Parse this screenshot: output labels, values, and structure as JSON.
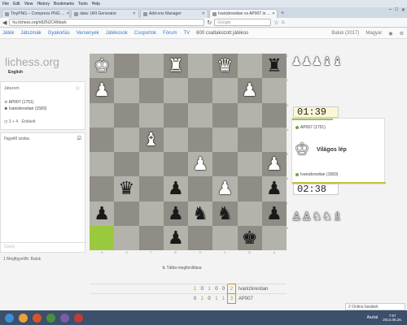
{
  "menubar": [
    "File",
    "Edit",
    "View",
    "History",
    "Bookmarks",
    "Tools",
    "Help"
  ],
  "tabs": [
    {
      "label": "TinyPNG – Compress PNG ...",
      "active": false
    },
    {
      "label": "data: URI Generator",
      "active": false
    },
    {
      "label": "Add-ons Manager",
      "active": false
    },
    {
      "label": "Ivanizkrestian vs AP007 in ...",
      "active": true
    }
  ],
  "window": {
    "min": "–",
    "max": "□",
    "close": "✕"
  },
  "url": "hu.lichess.org/n8ZNJC4/black",
  "search_placeholder": "Google",
  "nav": {
    "items": [
      "Játék",
      "Játszmák",
      "Gyakorlás",
      "Versenyek",
      "Játékosok",
      "Csoportok",
      "Fórum",
      "TV",
      "600 csatlakozott játékos"
    ],
    "user": "Baluk (2017)",
    "language": "Magyar"
  },
  "sidebar": {
    "logo": "lichess.org",
    "language": "English",
    "game_title": "Játszom",
    "player1": "AP007 (1751)",
    "player2": "Ivanizkrestian (1583)",
    "time_control": "3 + 4 · Értékelt",
    "chat_title": "Figyelő szoba",
    "chat_placeholder": "Üzenj",
    "watchers": "1 Megfigyelők: Baluk"
  },
  "board": {
    "rows": [
      [
        "wK",
        "",
        "",
        "wR",
        "",
        "wQ",
        "",
        "bR"
      ],
      [
        "wP",
        "",
        "",
        "",
        "",
        "",
        "wP",
        ""
      ],
      [
        "",
        "",
        "",
        "",
        "",
        "",
        "",
        ""
      ],
      [
        "",
        "",
        "wB",
        "",
        "",
        "",
        "",
        ""
      ],
      [
        "",
        "",
        "",
        "",
        "wP",
        "",
        "",
        "wP"
      ],
      [
        "",
        "bQ",
        "",
        "bP",
        "",
        "wP",
        "",
        "bP"
      ],
      [
        "bP",
        "",
        "",
        "bP",
        "bN",
        "bN",
        "",
        "bP"
      ],
      [
        "HL",
        "",
        "",
        "bP",
        "",
        "",
        "bK",
        ""
      ]
    ],
    "files": [
      "H",
      "G",
      "F",
      "E",
      "D",
      "C",
      "B",
      "A"
    ],
    "ranks": [
      "1",
      "2",
      "3",
      "4",
      "5",
      "6",
      "7",
      "8"
    ]
  },
  "captured_top": "♟♟♟♝♝",
  "captured_bottom": "♙♙♘♘♗",
  "clock_top": "01:39",
  "clock_bottom": "02:38",
  "panel": {
    "player_top": "AP007 (1751)",
    "turn_label": "Világos lép",
    "player_bottom": "Ivanizkrestian (1583)"
  },
  "flip_label": "Tábla megfordítása",
  "score": [
    {
      "results": [
        "1",
        "0",
        "1",
        "0",
        "0"
      ],
      "total": "2",
      "name": "Ivanizkrestian"
    },
    {
      "results": [
        "0",
        "1",
        "0",
        "1",
        "1"
      ],
      "total": "3",
      "name": "AP007"
    }
  ],
  "online_friends": "2 Online barátok",
  "taskbar": {
    "desktop": "Asztal",
    "time": "7:57",
    "date": "2014.06.26."
  }
}
